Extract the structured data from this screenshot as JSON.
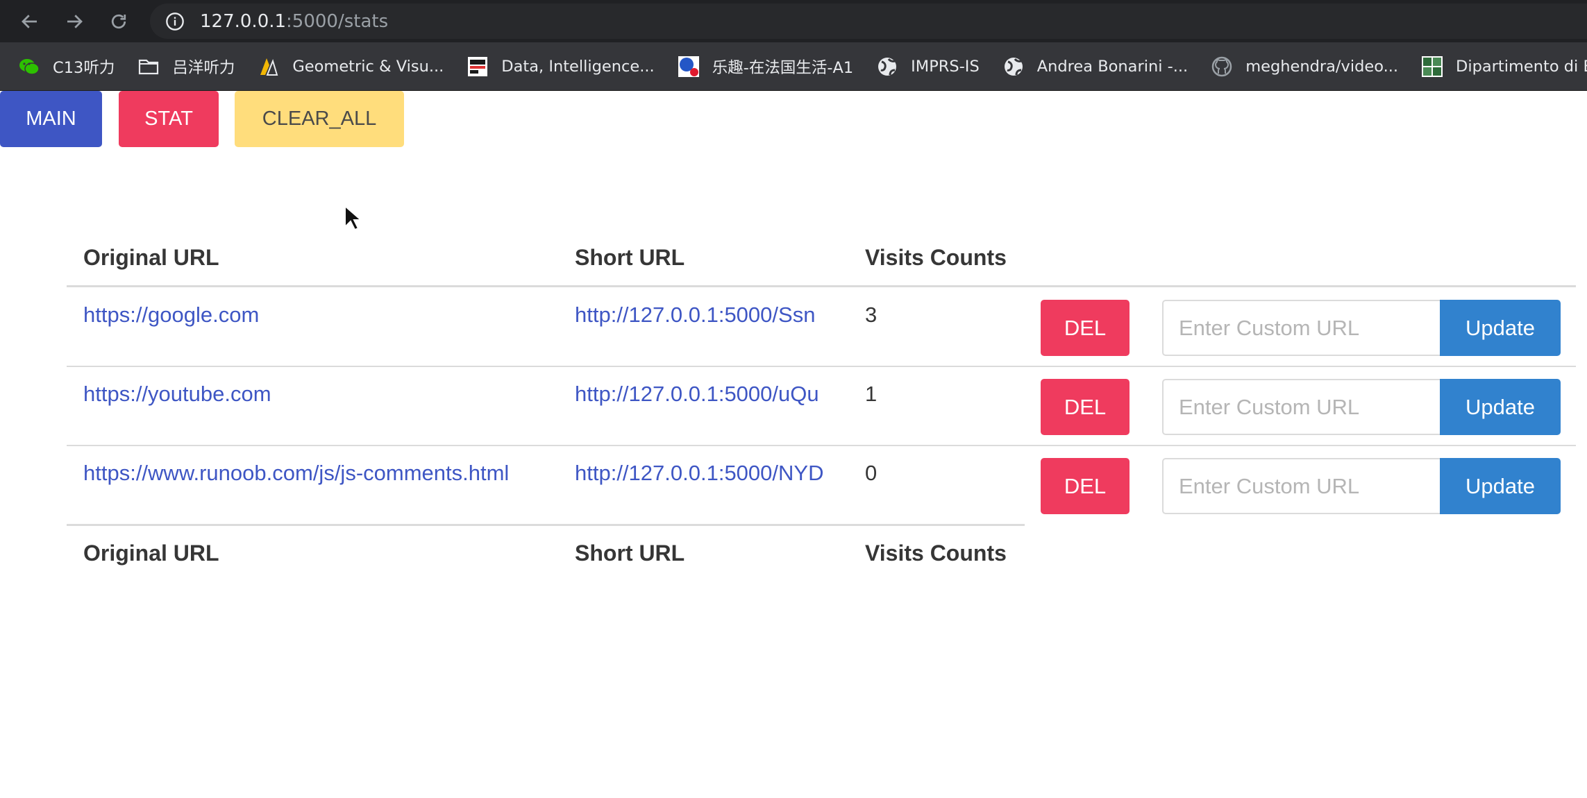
{
  "browser": {
    "url_host": "127.0.0.1",
    "url_path": ":5000/stats",
    "bookmarks": [
      {
        "label": "C13听力",
        "icon": "wechat-icon"
      },
      {
        "label": "吕洋听力",
        "icon": "folder-icon"
      },
      {
        "label": "Geometric & Visu...",
        "icon": "site-logo-icon"
      },
      {
        "label": "Data, Intelligence...",
        "icon": "site-logo-icon"
      },
      {
        "label": "乐趣-在法国生活-A1",
        "icon": "site-logo-icon"
      },
      {
        "label": "IMPRS-IS",
        "icon": "globe-icon"
      },
      {
        "label": "Andrea Bonarini -...",
        "icon": "globe-icon"
      },
      {
        "label": "meghendra/video...",
        "icon": "github-icon"
      },
      {
        "label": "Dipartimento di E",
        "icon": "site-logo-icon"
      }
    ]
  },
  "nav": {
    "main_label": "MAIN",
    "stat_label": "STAT",
    "clear_label": "CLEAR_ALL"
  },
  "table": {
    "headers": {
      "original": "Original URL",
      "short": "Short URL",
      "visits": "Visits Counts"
    },
    "rows": [
      {
        "original": "https://google.com",
        "short": "http://127.0.0.1:5000/Ssn",
        "visits": "3"
      },
      {
        "original": "https://youtube.com",
        "short": "http://127.0.0.1:5000/uQu",
        "visits": "1"
      },
      {
        "original": "https://www.runoob.com/js/js-comments.html",
        "short": "http://127.0.0.1:5000/NYD",
        "visits": "0"
      }
    ],
    "del_label": "DEL",
    "custom_placeholder": "Enter Custom URL",
    "update_label": "Update"
  },
  "colors": {
    "link": "#3e56c4",
    "main_button": "#3e56c4",
    "danger": "#ef3b5e",
    "warning": "#ffdd7c",
    "update_button": "#3182ce"
  }
}
